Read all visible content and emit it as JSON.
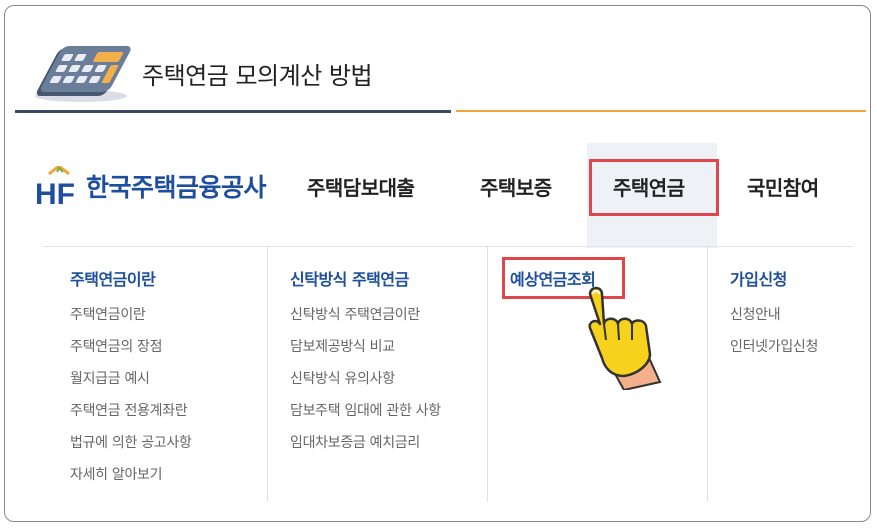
{
  "header": {
    "title": "주택연금 모의계산 방법"
  },
  "logo": {
    "mark": "HF",
    "name": "한국주택금융공사"
  },
  "nav": [
    {
      "label": "주택담보대출"
    },
    {
      "label": "주택보증"
    },
    {
      "label": "주택연금",
      "active": true
    },
    {
      "label": "국민참여"
    }
  ],
  "menu": {
    "columns": [
      {
        "heading": "주택연금이란",
        "items": [
          "주택연금이란",
          "주택연금의 장점",
          "월지급금 예시",
          "주택연금 전용계좌란",
          "법규에 의한 공고사항",
          "자세히 알아보기"
        ]
      },
      {
        "heading": "신탁방식 주택연금",
        "items": [
          "신탁방식 주택연금이란",
          "담보제공방식 비교",
          "신탁방식 유의사항",
          "담보주택 임대에 관한 사항",
          "임대차보증금 예치금리"
        ]
      },
      {
        "heading": "예상연금조회",
        "items": []
      },
      {
        "heading": "가입신청",
        "items": [
          "신청안내",
          "인터넷가입신청"
        ]
      }
    ]
  },
  "colors": {
    "brand": "#1d4f9e",
    "highlight": "#e0474c",
    "accent_orange": "#f2a33a",
    "navy_line": "#3a4a66"
  },
  "icons": [
    "calculator-icon",
    "pointing-hand-icon",
    "hf-logo-icon"
  ]
}
